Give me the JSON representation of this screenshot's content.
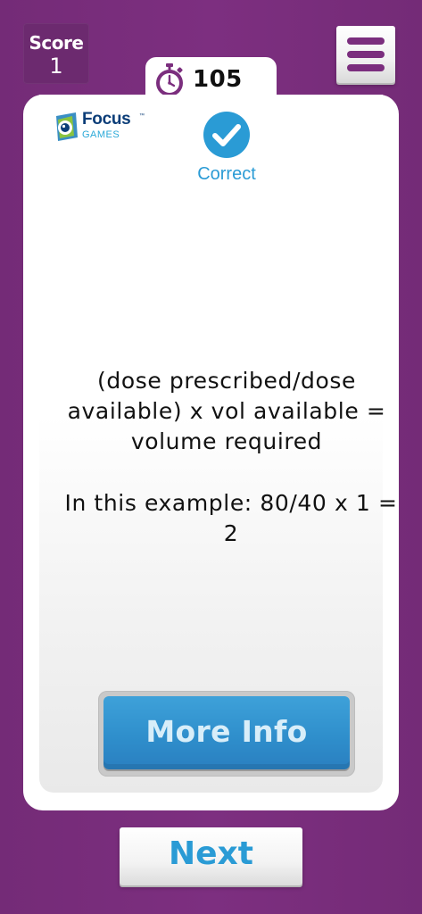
{
  "score": {
    "label": "Score",
    "value": "1"
  },
  "menu": {
    "icon": "hamburger-menu-icon"
  },
  "timer": {
    "icon": "stopwatch-icon",
    "value": "105"
  },
  "logo": {
    "name": "Focus",
    "trademark": "™",
    "subtitle": "GAMES"
  },
  "result": {
    "icon": "checkmark-circle-icon",
    "label": "Correct"
  },
  "explanation": {
    "formula": "(dose prescribed/dose available) x vol available = volume required",
    "example": "In this example: 80/40 x 1 = 2"
  },
  "buttons": {
    "more_info_label": "More Info",
    "next_label": "Next"
  },
  "colors": {
    "background": "#7b2e7e",
    "accent_blue": "#2a9bd5",
    "logo_navy": "#0b3d78",
    "card": "#ffffff"
  }
}
